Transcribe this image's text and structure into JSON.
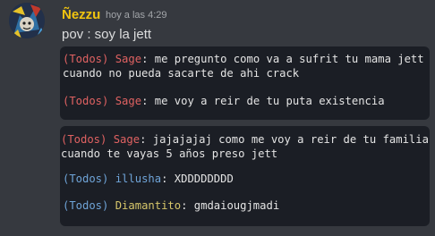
{
  "message": {
    "author": "Ñezzu",
    "timestamp": "hoy a las 4:29",
    "text": "pov : soy la jett",
    "avatar_icon": "avatar-icon"
  },
  "screenshot_1": {
    "lines": [
      {
        "channel": "(Todos)",
        "name": "Sage",
        "text": ": me pregunto como va a sufrit tu mama jett\ncuando no pueda sacarte de ahi crack"
      },
      {
        "channel": "(Todos)",
        "name": "Sage",
        "text": ": me voy a reir de tu puta existencia"
      }
    ]
  },
  "screenshot_2": {
    "lines": [
      {
        "channel": "(Todos)",
        "name": "Sage",
        "text": ": jajajajaj como me voy a reir de tu familia\ncuando te vayas 5 años preso jett"
      },
      {
        "channel": "(Todos)",
        "name": "illusha",
        "text": ": XDDDDDDDD"
      },
      {
        "channel": "(Todos)",
        "name": "Diamantito",
        "text": ": gmdaiougjmadi"
      }
    ]
  },
  "colors": {
    "background": "#36393f",
    "username": "#f1c40f",
    "chat_bg": "#1b1e25",
    "red_team": "#e06262",
    "blue_team": "#6fa4d8",
    "yellow_name": "#d6c66a"
  }
}
